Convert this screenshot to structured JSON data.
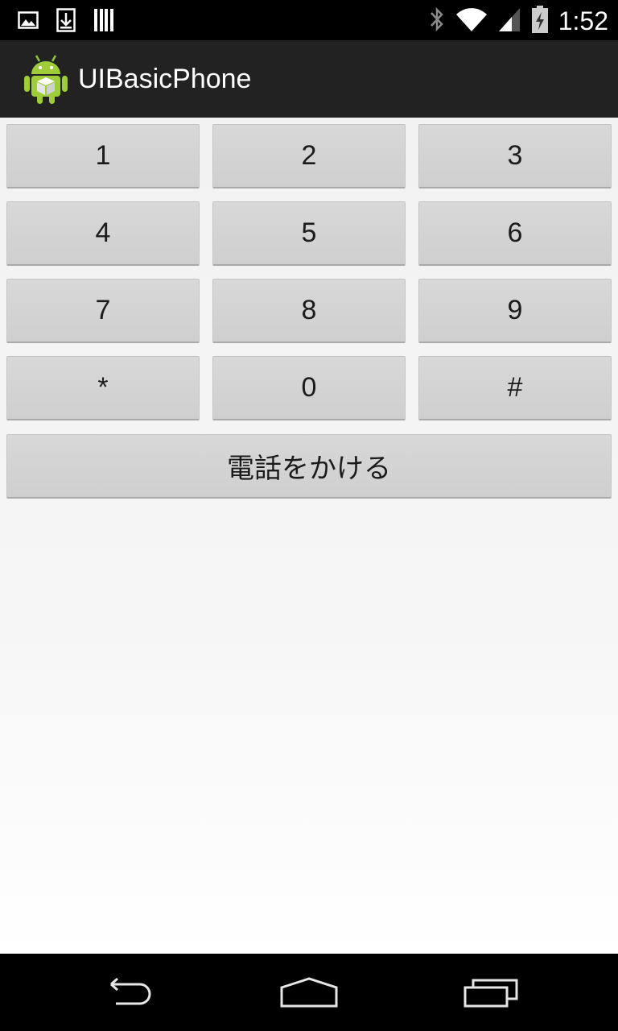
{
  "status_bar": {
    "time": "1:52",
    "left_icons": [
      "image-notification-icon",
      "download-notification-icon",
      "storage-notification-icon"
    ],
    "right_icons": [
      "bluetooth-icon",
      "wifi-icon",
      "cell-signal-icon",
      "battery-charging-icon"
    ]
  },
  "action_bar": {
    "title": "UIBasicPhone",
    "app_icon": "android-robot-icon"
  },
  "keypad": {
    "keys": [
      "1",
      "2",
      "3",
      "4",
      "5",
      "6",
      "7",
      "8",
      "9",
      "*",
      "0",
      "#"
    ]
  },
  "call_button": {
    "label": "電話をかける"
  },
  "nav_bar": {
    "buttons": [
      "back-icon",
      "home-icon",
      "recent-apps-icon"
    ]
  },
  "colors": {
    "status_bar_bg": "#000000",
    "action_bar_bg": "#222222",
    "content_bg": "#f2f2f2",
    "button_bg": "#d3d3d3",
    "button_text": "#1b1b1b"
  }
}
